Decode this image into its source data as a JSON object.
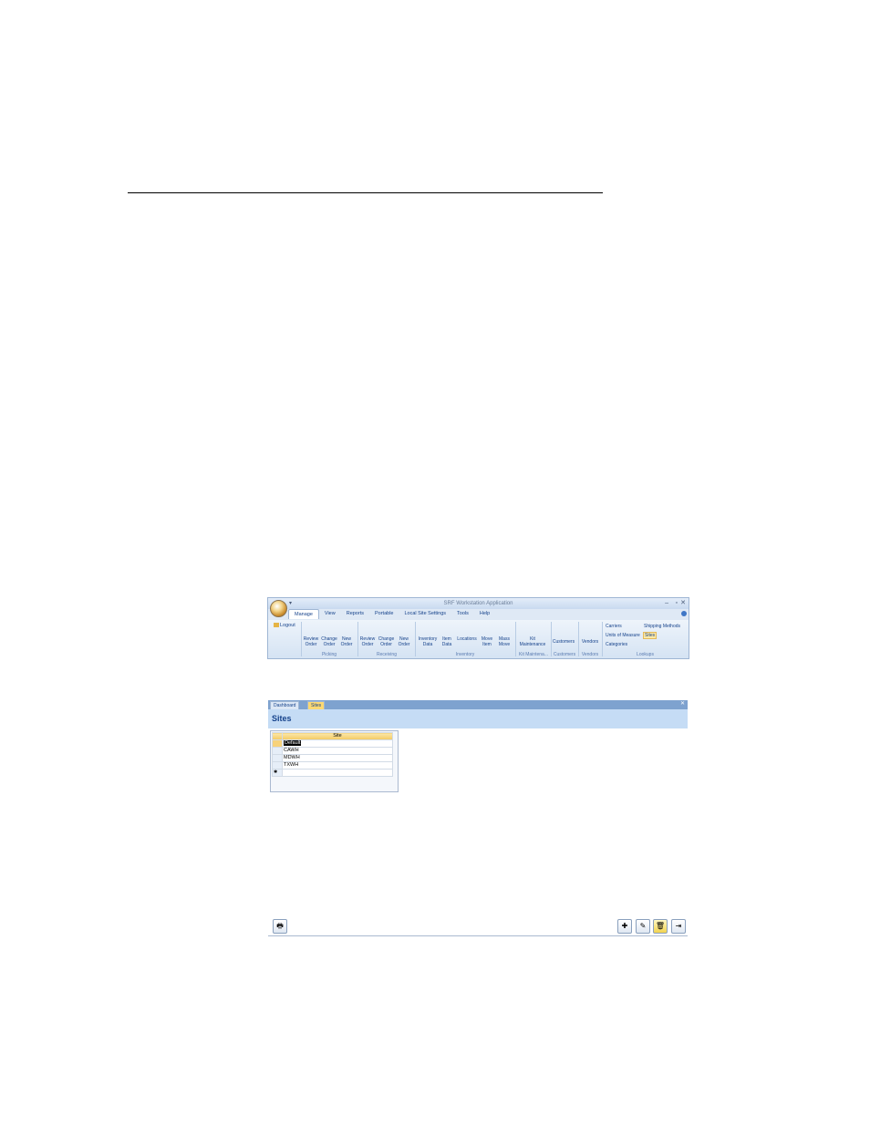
{
  "document": {
    "link_text_1": "",
    "link_text_2": ""
  },
  "ribbon_app": {
    "title": "SRF Workstation Application",
    "tabs": [
      "Manage",
      "View",
      "Reports",
      "Portable",
      "Local Site Settings",
      "Tools",
      "Help"
    ],
    "logout": "Logout",
    "groups": {
      "picking": "Picking",
      "receiving": "Receiving",
      "inventory": "Inventory",
      "kit": "Kit Maintena...",
      "customers": "Customers",
      "vendors": "Vendors",
      "lookups": "Lookups"
    },
    "buttons": {
      "review_order": "Review Order",
      "change_order": "Change Order",
      "new_order": "New Order",
      "review_order_r": "Review Order",
      "change_order_r": "Change Order",
      "new_order_r": "New Order",
      "inventory_data": "Inventory Data",
      "item_data": "Item Data",
      "locations": "Locations",
      "move_item": "Move Item",
      "mass_move": "Mass Move",
      "kit_maintenance": "Kit Maintenance",
      "customers": "Customers",
      "vendors": "Vendors"
    },
    "lookups": {
      "carriers": "Carriers",
      "shipping_methods": "Shipping Methods",
      "units_of_measure": "Units of Measure",
      "sites": "Sites",
      "categories": "Categories"
    }
  },
  "sites_form": {
    "doc_tabs": [
      "Dashboard",
      "Sites"
    ],
    "title": "Sites",
    "column_header": "Site",
    "rows": [
      "Default",
      "CAWH",
      "MDWH",
      "TXWH"
    ]
  }
}
